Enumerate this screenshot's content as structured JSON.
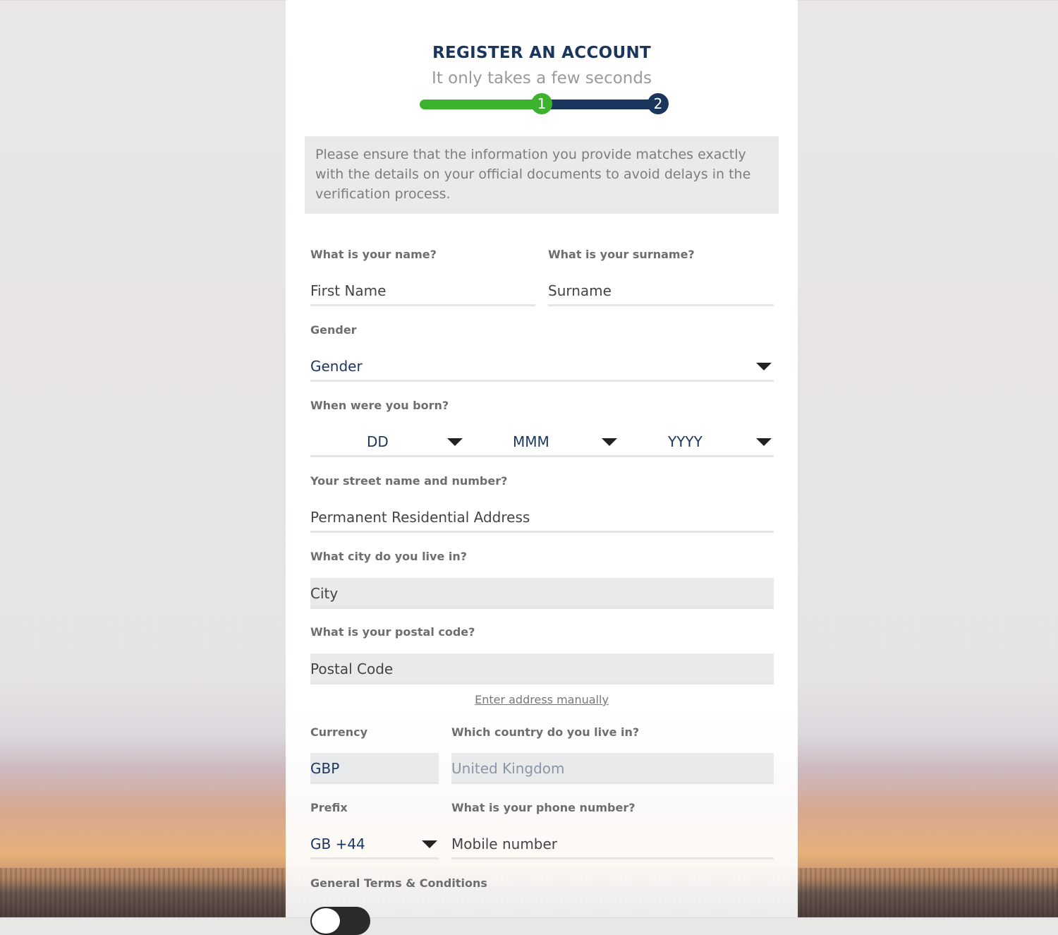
{
  "header": {
    "title": "REGISTER AN ACCOUNT",
    "subtitle": "It only takes a few seconds",
    "steps": [
      "1",
      "2"
    ],
    "current_step": 1,
    "progress_fraction": 0.5
  },
  "notice": "Please ensure that the information you provide matches exactly with the details on your official documents to avoid delays in the verification process.",
  "form": {
    "name": {
      "label": "What is your name?",
      "placeholder": "First Name"
    },
    "surname": {
      "label": "What is your surname?",
      "placeholder": "Surname"
    },
    "gender": {
      "label": "Gender",
      "selected": "Gender"
    },
    "dob": {
      "label": "When were you born?",
      "day": "DD",
      "month": "MMM",
      "year": "YYYY"
    },
    "street": {
      "label": "Your street name and number?",
      "placeholder": "Permanent Residential Address"
    },
    "city": {
      "label": "What city do you live in?",
      "placeholder": "City"
    },
    "postal": {
      "label": "What is your postal code?",
      "placeholder": "Postal Code"
    },
    "manual_link": "Enter address manually",
    "currency": {
      "label": "Currency",
      "value": "GBP"
    },
    "country": {
      "label": "Which country do you live in?",
      "value": "United Kingdom"
    },
    "prefix": {
      "label": "Prefix",
      "selected": "GB +44"
    },
    "phone": {
      "label": "What is your phone number?",
      "placeholder": "Mobile number"
    },
    "terms": {
      "label": "General Terms & Conditions",
      "toggle_on": false
    }
  },
  "colors": {
    "navy": "#1b365d",
    "green": "#3cb22f",
    "notice_bg": "#e9eaec"
  }
}
